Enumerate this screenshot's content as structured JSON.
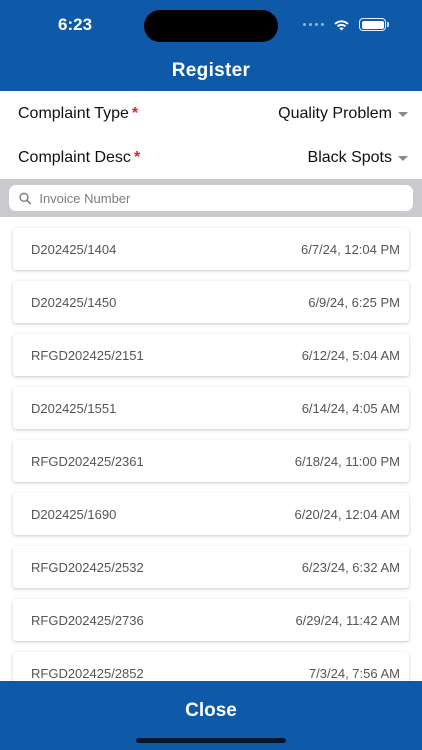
{
  "status_bar": {
    "time": "6:23"
  },
  "header": {
    "title": "Register"
  },
  "form": {
    "complaint_type": {
      "label": "Complaint Type",
      "required_mark": "*",
      "value": "Quality Problem"
    },
    "complaint_desc": {
      "label": "Complaint Desc",
      "required_mark": "*",
      "value": "Black Spots"
    }
  },
  "search": {
    "placeholder": "Invoice Number",
    "value": ""
  },
  "invoices": [
    {
      "number": "D202425/1404",
      "date": "6/7/24, 12:04 PM"
    },
    {
      "number": "D202425/1450",
      "date": "6/9/24, 6:25 PM"
    },
    {
      "number": "RFGD202425/2151",
      "date": "6/12/24, 5:04 AM"
    },
    {
      "number": "D202425/1551",
      "date": "6/14/24, 4:05 AM"
    },
    {
      "number": "RFGD202425/2361",
      "date": "6/18/24, 11:00 PM"
    },
    {
      "number": "D202425/1690",
      "date": "6/20/24, 12:04 AM"
    },
    {
      "number": "RFGD202425/2532",
      "date": "6/23/24, 6:32 AM"
    },
    {
      "number": "RFGD202425/2736",
      "date": "6/29/24, 11:42 AM"
    },
    {
      "number": "RFGD202425/2852",
      "date": "7/3/24, 7:56 AM"
    }
  ],
  "footer": {
    "close_label": "Close"
  },
  "colors": {
    "primary": "#0e5aa8",
    "required": "#e0202a",
    "search_band": "#c9c9ce"
  }
}
